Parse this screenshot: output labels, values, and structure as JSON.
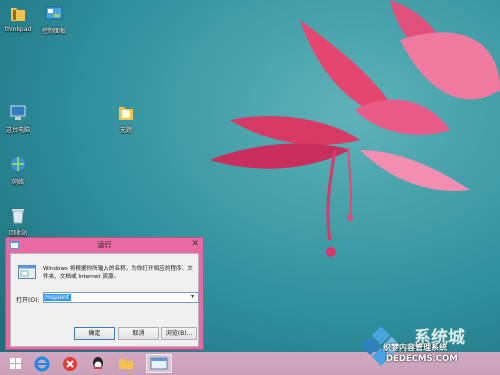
{
  "desktop": {
    "icons": [
      {
        "label": "thinkpad"
      },
      {
        "label": "控制面板"
      },
      {
        "label": "这台电脑"
      },
      {
        "label": "无题"
      },
      {
        "label": "网络"
      },
      {
        "label": "回收站"
      }
    ]
  },
  "run_dialog": {
    "title": "运行",
    "description": "Windows 将根据你所输入的名称，为你打开相应的程序、文件夹、文档或 Internet 资源。",
    "open_label": "打开(O):",
    "command_value": "mspaint",
    "buttons": {
      "ok": "确定",
      "cancel": "取消",
      "browse": "浏览(B)..."
    }
  },
  "taskbar": {
    "items": [
      "start-icon",
      "ie-icon",
      "antivirus-icon",
      "qq-icon",
      "explorer-icon",
      "run-icon"
    ],
    "active_item": "run-icon"
  },
  "watermark": {
    "brand": "系统城",
    "slogan": "织梦内容管理系统",
    "site": "DEDECMS.COM"
  }
}
